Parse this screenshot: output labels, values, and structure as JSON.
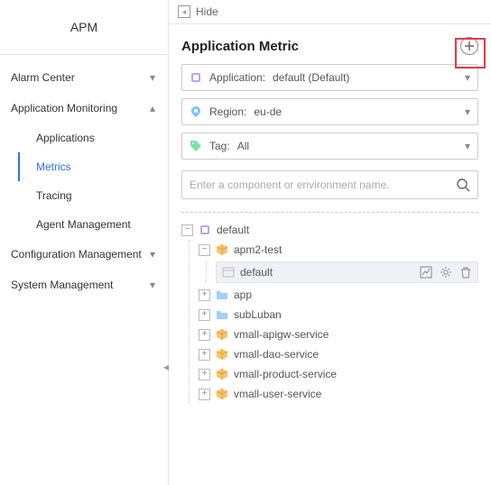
{
  "sidebar": {
    "title": "APM",
    "items": [
      {
        "label": "Alarm Center",
        "expanded": false,
        "children": []
      },
      {
        "label": "Application Monitoring",
        "expanded": true,
        "children": [
          {
            "label": "Applications"
          },
          {
            "label": "Metrics",
            "active": true
          },
          {
            "label": "Tracing"
          },
          {
            "label": "Agent Management"
          }
        ]
      },
      {
        "label": "Configuration Management",
        "expanded": false,
        "children": []
      },
      {
        "label": "System Management",
        "expanded": false,
        "children": []
      }
    ]
  },
  "main": {
    "hide_label": "Hide",
    "title": "Application Metric",
    "filters": {
      "application": {
        "label": "Application:",
        "value": "default (Default)"
      },
      "region": {
        "label": "Region:",
        "value": "eu-de"
      },
      "tag": {
        "label": "Tag:",
        "value": "All"
      }
    },
    "search_placeholder": "Enter a component or environment name.",
    "tree": {
      "root": {
        "label": "default",
        "expanded": true,
        "children": [
          {
            "label": "apm2-test",
            "icon": "cube",
            "expanded": true,
            "children": [
              {
                "label": "default",
                "icon": "env",
                "leaf": true
              }
            ]
          },
          {
            "label": "app",
            "icon": "folder",
            "expanded": false
          },
          {
            "label": "subLuban",
            "icon": "folder",
            "expanded": false
          },
          {
            "label": "vmall-apigw-service",
            "icon": "cube",
            "expanded": false
          },
          {
            "label": "vmall-dao-service",
            "icon": "cube",
            "expanded": false
          },
          {
            "label": "vmall-product-service",
            "icon": "cube",
            "expanded": false
          },
          {
            "label": "vmall-user-service",
            "icon": "cube",
            "expanded": false
          }
        ]
      }
    }
  }
}
